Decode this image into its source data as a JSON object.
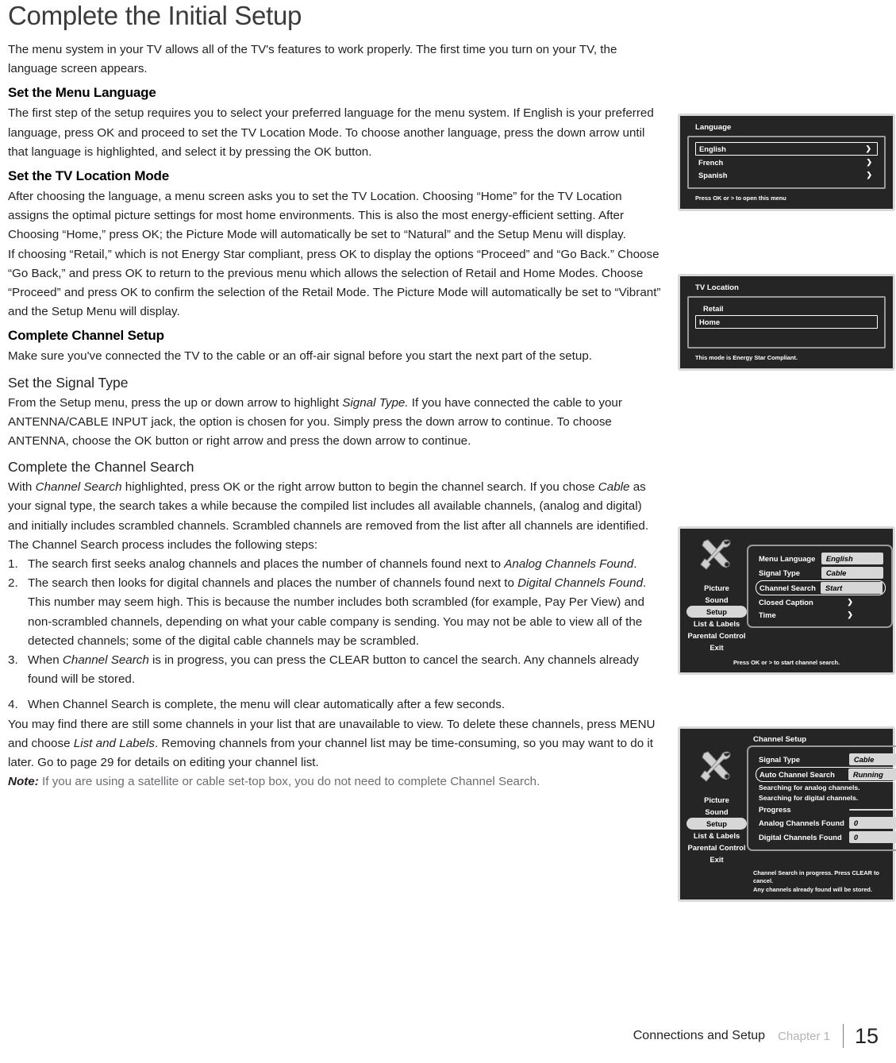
{
  "page": {
    "title": "Complete the Initial Setup",
    "intro": "The menu system in your TV allows all of the TV's features to work properly. The first time you turn on your TV, the language screen appears."
  },
  "sections": {
    "menu_language": {
      "heading": "Set the Menu Language",
      "body": "The first step of the setup requires you to select your preferred language for the menu system. If English is your preferred language, press OK and proceed to set the TV Location Mode. To choose another language, press the down arrow until that language is highlighted, and select it by pressing the OK button."
    },
    "tv_location": {
      "heading": "Set the TV Location Mode",
      "body1": "After choosing the language, a menu screen asks you to set the TV Location. Choosing “Home” for the TV Location assigns the optimal picture settings for most home environments. This is also the most energy-efficient setting. After Choosing “Home,” press OK; the Picture Mode will automatically be set to “Natural” and the Setup Menu will display.",
      "body2": "If choosing “Retail,” which is not Energy Star compliant, press OK to display the options “Proceed” and “Go Back.” Choose “Go Back,” and press OK to return to the previous menu which allows the selection of Retail and Home Modes. Choose “Proceed” and press OK to confirm the selection of the Retail Mode. The Picture Mode will automatically be set to “Vibrant” and the Setup Menu will display."
    },
    "channel_setup": {
      "heading": "Complete Channel Setup",
      "body": "Make sure you've connected the TV to the cable or an off-air signal before you start the next part of the setup."
    },
    "signal_type": {
      "heading": "Set the Signal Type",
      "body_a": "From the Setup menu, press the up or down arrow to highlight ",
      "body_italic": "Signal Type.",
      "body_b": " If you have connected the cable to your ANTENNA/CABLE INPUT jack, the option is chosen for you. Simply press the down arrow to continue. To choose ANTENNA, choose the OK button or right arrow and press the down arrow to continue."
    },
    "channel_search": {
      "heading": "Complete the Channel Search",
      "intro_a": "With ",
      "intro_italic": "Channel Search",
      "intro_b": " highlighted, press OK or the right arrow button to begin the channel search. If you chose ",
      "intro_italic2": "Cable",
      "intro_c": " as your signal type, the search takes a while because the compiled list includes all available channels, (analog and digital) and initially includes scrambled channels. Scrambled channels are removed from the list after all channels are identified.",
      "steps_lead": "The Channel Search process includes the following steps:",
      "steps": [
        {
          "num": "1.",
          "a": "The search first seeks analog channels and places the number of channels found next to ",
          "i": "Analog Channels Found",
          "b": "."
        },
        {
          "num": "2.",
          "a": "The search then looks for digital channels and places the number of channels found next to ",
          "i": "Digital Channels Found",
          "b": ". This number may seem high. This is because the number includes both scrambled (for example, Pay Per View) and non-scrambled channels, depending on what your cable company is sending. You may not be able to view all of the detected channels; some of the digital cable channels may be scrambled."
        },
        {
          "num": "3.",
          "a": "When ",
          "i": "Channel Search",
          "b": " is in progress, you can press the CLEAR button to cancel the search. Any channels already found will be stored."
        },
        {
          "num": "4.",
          "a": "When Channel Search is complete, the menu will clear automatically after a few seconds.",
          "i": "",
          "b": ""
        }
      ],
      "closing_a": "You may find there are still some channels in your list that are unavailable to view. To delete these channels, press MENU and choose ",
      "closing_italic": "List and Labels",
      "closing_b": ". Removing channels from your channel list may be time-consuming, so you may want to do it later. Go to page 29 for details on editing your channel list.",
      "note_label": "Note:",
      "note_text": " If you are using a satellite or cable set-top box, you do not need to complete Channel Search."
    }
  },
  "tv_menus": {
    "language": {
      "title": "Language",
      "items": [
        {
          "label": "English",
          "arrow": "❯",
          "selected": true
        },
        {
          "label": "French",
          "arrow": "❯",
          "selected": false
        },
        {
          "label": "Spanish",
          "arrow": "❯",
          "selected": false
        }
      ],
      "footer": "Press OK or > to open this menu"
    },
    "tv_location": {
      "title": "TV Location",
      "items": [
        {
          "label": "Retail",
          "selected": false
        },
        {
          "label": "Home",
          "selected": true
        }
      ],
      "footer": "This mode is Energy Star Compliant."
    },
    "setup": {
      "title": "",
      "sidebar": [
        {
          "label": "Picture",
          "active": false
        },
        {
          "label": "Sound",
          "active": false
        },
        {
          "label": "Setup",
          "active": true
        },
        {
          "label": "List & Labels",
          "active": false
        },
        {
          "label": "Parental Control",
          "active": false
        },
        {
          "label": "Exit",
          "active": false
        }
      ],
      "rows": [
        {
          "label": "Menu Language",
          "value": "English",
          "arrow": "",
          "selected": false
        },
        {
          "label": "Signal Type",
          "value": "Cable",
          "arrow": "",
          "selected": false
        },
        {
          "label": "Channel Search",
          "value": "Start",
          "arrow": "",
          "selected": true
        },
        {
          "label": "Closed Caption",
          "value": "",
          "arrow": "❯",
          "selected": false
        },
        {
          "label": "Time",
          "value": "",
          "arrow": "❯",
          "selected": false
        }
      ],
      "footer": "Press OK or  > to start channel search."
    },
    "channel_setup": {
      "title": "Channel Setup",
      "sidebar": [
        {
          "label": "Picture",
          "active": false
        },
        {
          "label": "Sound",
          "active": false
        },
        {
          "label": "Setup",
          "active": true
        },
        {
          "label": "List & Labels",
          "active": false
        },
        {
          "label": "Parental Control",
          "active": false
        },
        {
          "label": "Exit",
          "active": false
        }
      ],
      "rows": [
        {
          "label": "Signal Type",
          "value": "Cable",
          "selected": false,
          "type": "pill"
        },
        {
          "label": "Auto Channel Search",
          "value": "Running",
          "selected": true,
          "type": "pill"
        },
        {
          "label": "Searching for analog channels.",
          "value": "",
          "selected": false,
          "type": "note"
        },
        {
          "label": "Searching for digital channels.",
          "value": "",
          "selected": false,
          "type": "note"
        },
        {
          "label": "Progress",
          "value": "",
          "selected": false,
          "type": "pill"
        },
        {
          "label": "Analog Channels Found",
          "value": "0",
          "selected": false,
          "type": "pill"
        },
        {
          "label": "Digital Channels Found",
          "value": "0",
          "selected": false,
          "type": "pill"
        }
      ],
      "footer_line1": "Channel Search in progress. Press CLEAR  to cancel.",
      "footer_line2": "Any channels already found will be stored."
    }
  },
  "footer": {
    "section": "Connections and Setup",
    "chapter": "Chapter 1",
    "page_number": "15"
  },
  "colors": {
    "menu_bg": "#252525",
    "menu_frame": "#d9d9d9",
    "pill_bg": "#d7d7d7",
    "note_grey": "#6d6e71"
  }
}
